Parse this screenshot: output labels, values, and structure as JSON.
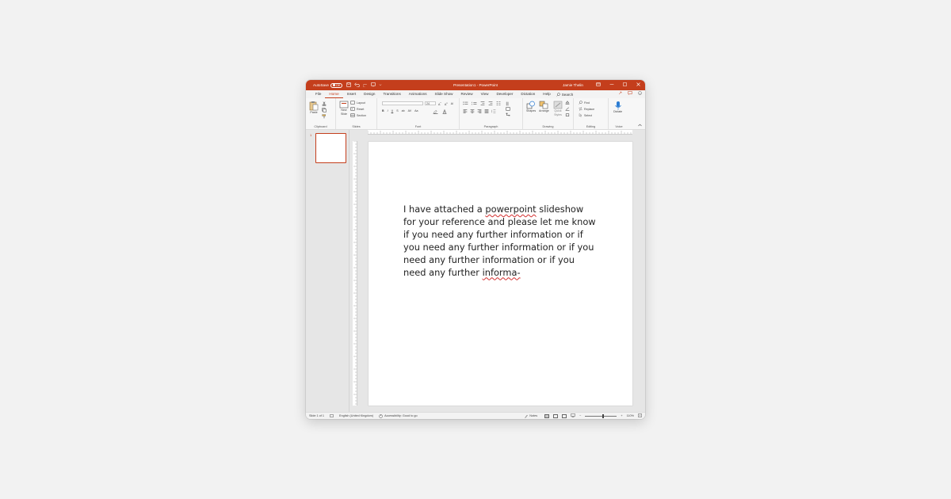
{
  "window": {
    "title": "Presentation1  -  PowerPoint",
    "user": "Jamie Thelin",
    "autosave_label": "AutoSave",
    "autosave_state": "Off"
  },
  "tabs": [
    "File",
    "Home",
    "Insert",
    "Design",
    "Transitions",
    "Animations",
    "Slide Show",
    "Review",
    "View",
    "Developer",
    "Dictation",
    "Help"
  ],
  "active_tab": "Home",
  "search_label": "Search",
  "ribbon": {
    "clipboard": {
      "label": "Clipboard",
      "paste": "Paste"
    },
    "slides": {
      "label": "Slides",
      "new_slide": "New Slide",
      "layout": "Layout",
      "reset": "Reset",
      "section": "Section"
    },
    "font": {
      "label": "Font",
      "font_size": "24",
      "font_name": ""
    },
    "paragraph": {
      "label": "Paragraph"
    },
    "drawing": {
      "label": "Drawing",
      "shapes": "Shapes",
      "arrange": "Arrange",
      "quick_styles": "Quick Styles"
    },
    "editing": {
      "label": "Editing",
      "find": "Find",
      "replace": "Replace",
      "select": "Select"
    },
    "voice": {
      "label": "Voice",
      "dictate": "Dictate"
    }
  },
  "thumbnails": [
    {
      "number": "1"
    }
  ],
  "slide": {
    "text_part1": "I have attached a ",
    "text_misspelled1": "powerpoint",
    "text_part2": " slideshow for your reference and please let me know if you need any further information or if you need any further information or if you need any further information or if you need any further ",
    "text_misspelled2": "informa-"
  },
  "status": {
    "slide_info": "Slide 1 of 1",
    "language": "English (United Kingdom)",
    "accessibility": "Accessibility: Good to go",
    "notes": "Notes",
    "zoom": "110%"
  },
  "colors": {
    "accent": "#c43e1c",
    "spellcheck": "#d32f2f"
  }
}
